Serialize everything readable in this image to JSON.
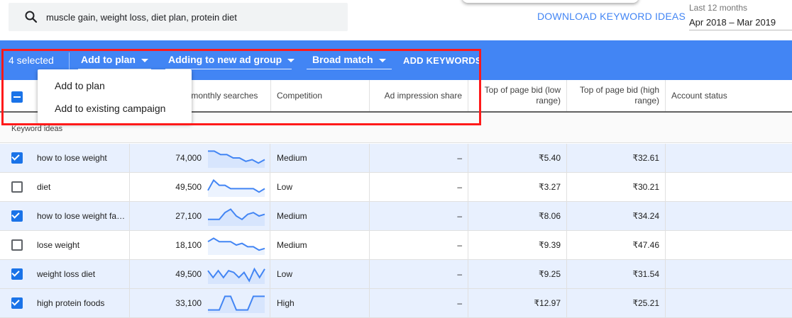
{
  "search": {
    "query": "muscle gain, weight loss, diet plan, protein diet"
  },
  "download_label": "DOWNLOAD KEYWORD IDEAS",
  "date_range": {
    "label": "Last 12 months",
    "value": "Apr 2018 – Mar 2019"
  },
  "toolbar": {
    "selected_text": "4 selected",
    "add_to_plan": "Add to plan",
    "ad_group": "Adding to new ad group",
    "match_type": "Broad match",
    "add_keywords": "ADD KEYWORDS"
  },
  "menu": {
    "items": [
      "Add to plan",
      "Add to existing campaign"
    ]
  },
  "columns": {
    "searches": "g. monthly searches",
    "competition": "Competition",
    "impression_share": "Ad impression share",
    "bid_low": "Top of page bid (low range)",
    "bid_high": "Top of page bid (high range)",
    "account_status": "Account status"
  },
  "group_label": "Keyword ideas",
  "rows": [
    {
      "keyword": "how to lose weight",
      "checked": true,
      "searches": "74,000",
      "competition": "Medium",
      "impression": "–",
      "bid_low": "₹5.40",
      "bid_high": "₹32.61",
      "trend": [
        9,
        9,
        7,
        7,
        5,
        5,
        3,
        4,
        2,
        4
      ]
    },
    {
      "keyword": "diet",
      "checked": false,
      "searches": "49,500",
      "competition": "Low",
      "impression": "–",
      "bid_low": "₹3.27",
      "bid_high": "₹30.21",
      "trend": [
        3,
        9,
        6,
        6,
        4,
        4,
        4,
        4,
        4,
        2,
        4
      ]
    },
    {
      "keyword": "how to lose weight fa…",
      "checked": true,
      "searches": "27,100",
      "competition": "Medium",
      "impression": "–",
      "bid_low": "₹8.06",
      "bid_high": "₹34.24",
      "trend": [
        3,
        3,
        3,
        7,
        9,
        5,
        3,
        6,
        7,
        5,
        6
      ]
    },
    {
      "keyword": "lose weight",
      "checked": false,
      "searches": "18,100",
      "competition": "Medium",
      "impression": "–",
      "bid_low": "₹9.39",
      "bid_high": "₹47.46",
      "trend": [
        7,
        9,
        7,
        7,
        7,
        5,
        6,
        4,
        4,
        2,
        3
      ]
    },
    {
      "keyword": "weight loss diet",
      "checked": true,
      "searches": "49,500",
      "competition": "Low",
      "impression": "–",
      "bid_low": "₹9.25",
      "bid_high": "₹31.54",
      "trend": [
        7,
        3,
        7,
        3,
        7,
        6,
        3,
        6,
        1,
        8,
        3,
        8
      ]
    },
    {
      "keyword": "high protein foods",
      "checked": true,
      "searches": "33,100",
      "competition": "High",
      "impression": "–",
      "bid_low": "₹12.97",
      "bid_high": "₹25.21",
      "trend": [
        1,
        1,
        1,
        9,
        9,
        1,
        1,
        1,
        9,
        9,
        9
      ]
    }
  ],
  "colors": {
    "accent": "#4285f4",
    "selected_row": "#e8f0fe",
    "annotation": "#ff1a1a",
    "sparkline": "#4285f4"
  }
}
